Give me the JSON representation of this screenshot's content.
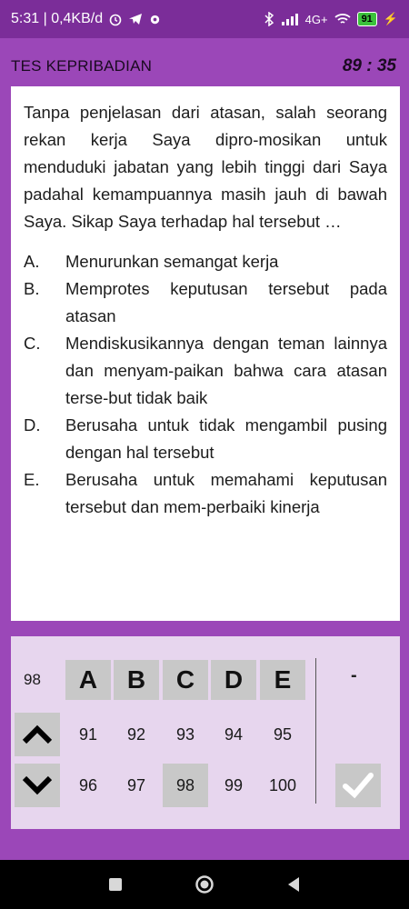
{
  "status_bar": {
    "time_data": "5:31 | 0,4KB/d",
    "network": "4G+",
    "battery": "91"
  },
  "header": {
    "title": "TES KEPRIBADIAN",
    "timer": "89 : 35"
  },
  "question": {
    "text": "Tanpa penjelasan dari atasan, salah seorang rekan kerja Saya dipro-mosikan untuk menduduki jabatan yang lebih tinggi dari Saya padahal kemampuannya masih jauh di bawah Saya. Sikap Saya terhadap hal tersebut …",
    "options": [
      {
        "letter": "A.",
        "text": "Menurunkan semangat kerja"
      },
      {
        "letter": "B.",
        "text": "Memprotes keputusan tersebut pada atasan"
      },
      {
        "letter": "C.",
        "text": "Mendiskusikannya dengan teman lainnya dan menyam-paikan bahwa cara atasan terse-but tidak baik"
      },
      {
        "letter": "D.",
        "text": "Berusaha untuk tidak mengambil pusing dengan hal tersebut"
      },
      {
        "letter": "E.",
        "text": "Berusaha untuk memahami keputusan tersebut dan mem-perbaiki kinerja"
      }
    ]
  },
  "panel": {
    "current_number": "98",
    "answer_buttons": [
      "A",
      "B",
      "C",
      "D",
      "E"
    ],
    "selected_answer": "-",
    "row1_numbers": [
      "91",
      "92",
      "93",
      "94",
      "95"
    ],
    "row2_numbers": [
      "96",
      "97",
      "98",
      "99",
      "100"
    ],
    "active_number": "98"
  },
  "colors": {
    "background": "#9b47b8",
    "status_bar": "#7b2d99",
    "panel": "#e7d6ee",
    "button": "#c8c8c8"
  }
}
